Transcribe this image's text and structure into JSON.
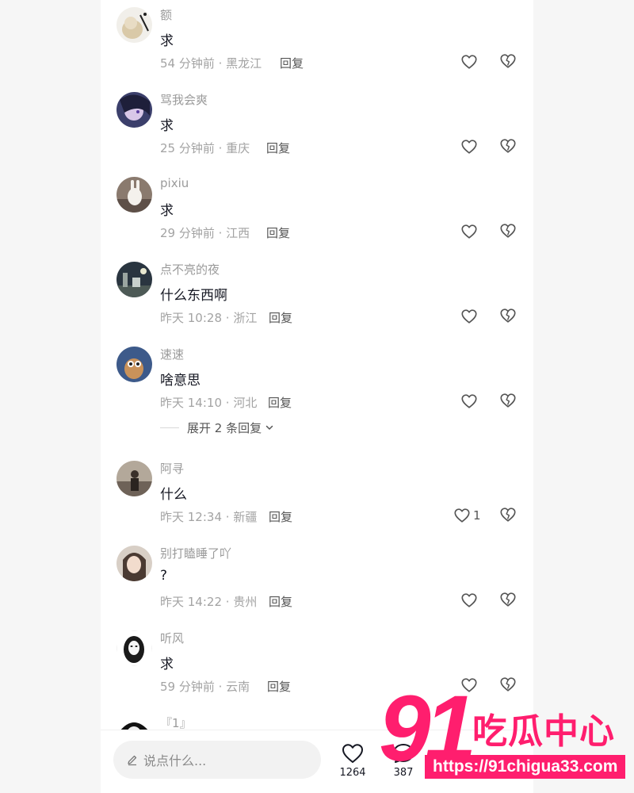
{
  "comments": [
    {
      "username": "额",
      "text": "求",
      "time": "54 分钟前",
      "location": "黑龙江",
      "reply": "回复",
      "likes": ""
    },
    {
      "username": "骂我会爽",
      "text": "求",
      "time": "25 分钟前",
      "location": "重庆",
      "reply": "回复",
      "likes": ""
    },
    {
      "username": "pixiu",
      "text": "求",
      "time": "29 分钟前",
      "location": "江西",
      "reply": "回复",
      "likes": ""
    },
    {
      "username": "点不亮的夜",
      "text": "什么东西啊",
      "time": "昨天 10:28",
      "location": "浙江",
      "reply": "回复",
      "likes": ""
    },
    {
      "username": "速速",
      "text": "啥意思",
      "time": "昨天 14:10",
      "location": "河北",
      "reply": "回复",
      "likes": ""
    },
    {
      "username": "阿寻",
      "text": "什么",
      "time": "昨天 12:34",
      "location": "新疆",
      "reply": "回复",
      "likes": "1"
    },
    {
      "username": "别打瞌睡了吖",
      "text": "?",
      "time": "昨天 14:22",
      "location": "贵州",
      "reply": "回复",
      "likes": ""
    },
    {
      "username": "听风",
      "text": "求",
      "time": "59 分钟前",
      "location": "云南",
      "reply": "回复",
      "likes": ""
    },
    {
      "username": "『1』",
      "text": "",
      "time": "",
      "location": "",
      "reply": "",
      "likes": ""
    }
  ],
  "expand_replies": "展开 2 条回复",
  "bottom": {
    "input_placeholder": "说点什么...",
    "like_count": "1264",
    "comment_count": "387"
  },
  "watermark": {
    "number": "91",
    "brand": "吃瓜中心",
    "url": "https://91chigua33.com"
  },
  "colors": {
    "background": "#f6f6f6",
    "panel": "#ffffff",
    "primary_text": "#161823",
    "secondary_text": "#a3a3a3",
    "watermark": "#ff1e6e"
  }
}
